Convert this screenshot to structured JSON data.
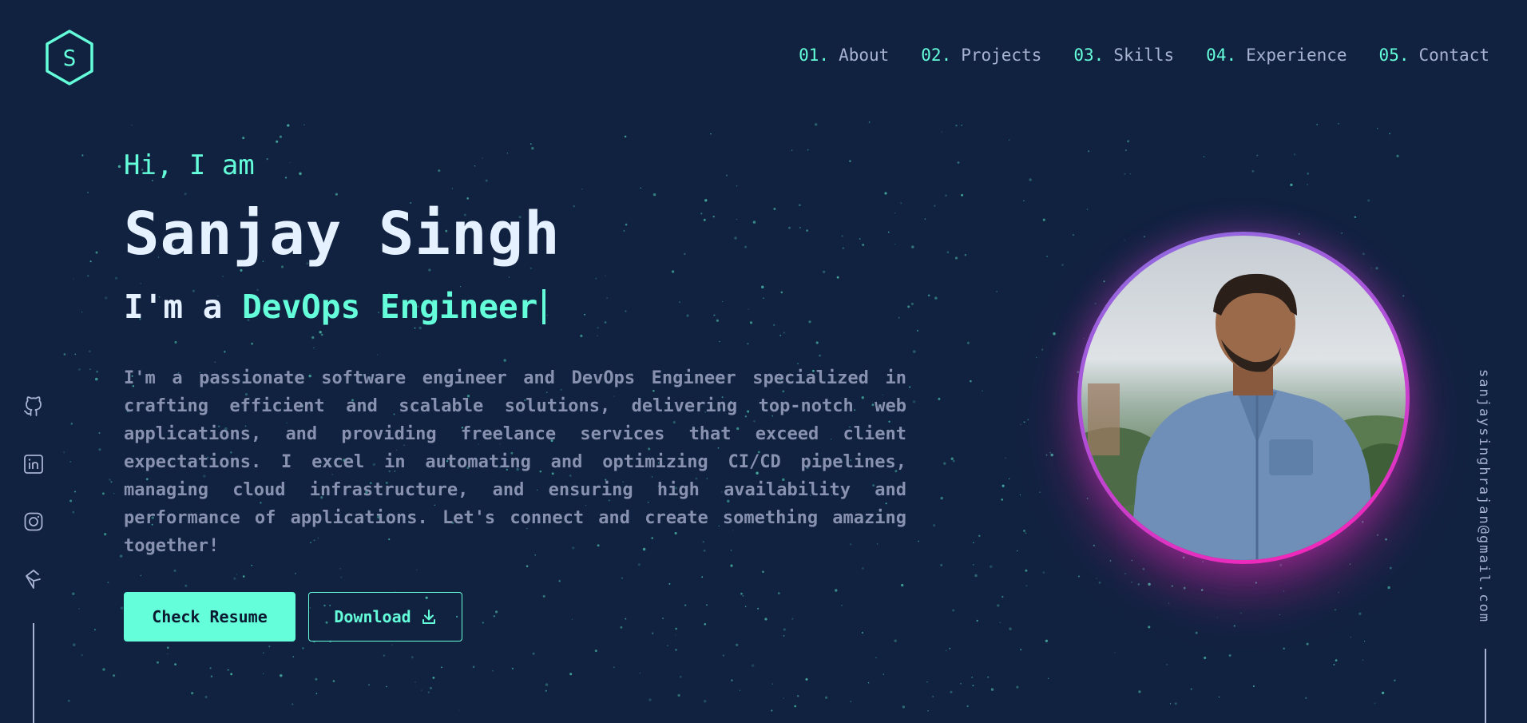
{
  "logo": {
    "letter": "S"
  },
  "nav": {
    "items": [
      {
        "num": "01.",
        "label": "About"
      },
      {
        "num": "02.",
        "label": "Projects"
      },
      {
        "num": "03.",
        "label": "Skills"
      },
      {
        "num": "04.",
        "label": "Experience"
      },
      {
        "num": "05.",
        "label": "Contact"
      }
    ]
  },
  "hero": {
    "greeting": "Hi, I am",
    "name": "Sanjay Singh",
    "role_prefix": "I'm a ",
    "role_highlight": "DevOps Engineer",
    "bio": "I'm a passionate software engineer and DevOps Engineer specialized in crafting efficient and scalable solutions, delivering top-notch web applications, and providing freelance services that exceed client expectations. I excel in automating and optimizing CI/CD pipelines, managing cloud infrastructure, and ensuring high availability and performance of applications. Let's connect and create something amazing together!",
    "primary_button": "Check Resume",
    "secondary_button": "Download"
  },
  "social": {
    "icons": [
      "github-icon",
      "linkedin-icon",
      "instagram-icon",
      "codepen-icon"
    ]
  },
  "email": "sanjaysinghrajan@gmail.com",
  "colors": {
    "background": "#112240",
    "accent": "#64ffda",
    "text_light": "#e6f1ff",
    "text_muted": "#8892b0",
    "nav_text": "#a8b2d1",
    "ring_top": "#8a6fe0",
    "ring_bottom": "#ff1fb4"
  }
}
